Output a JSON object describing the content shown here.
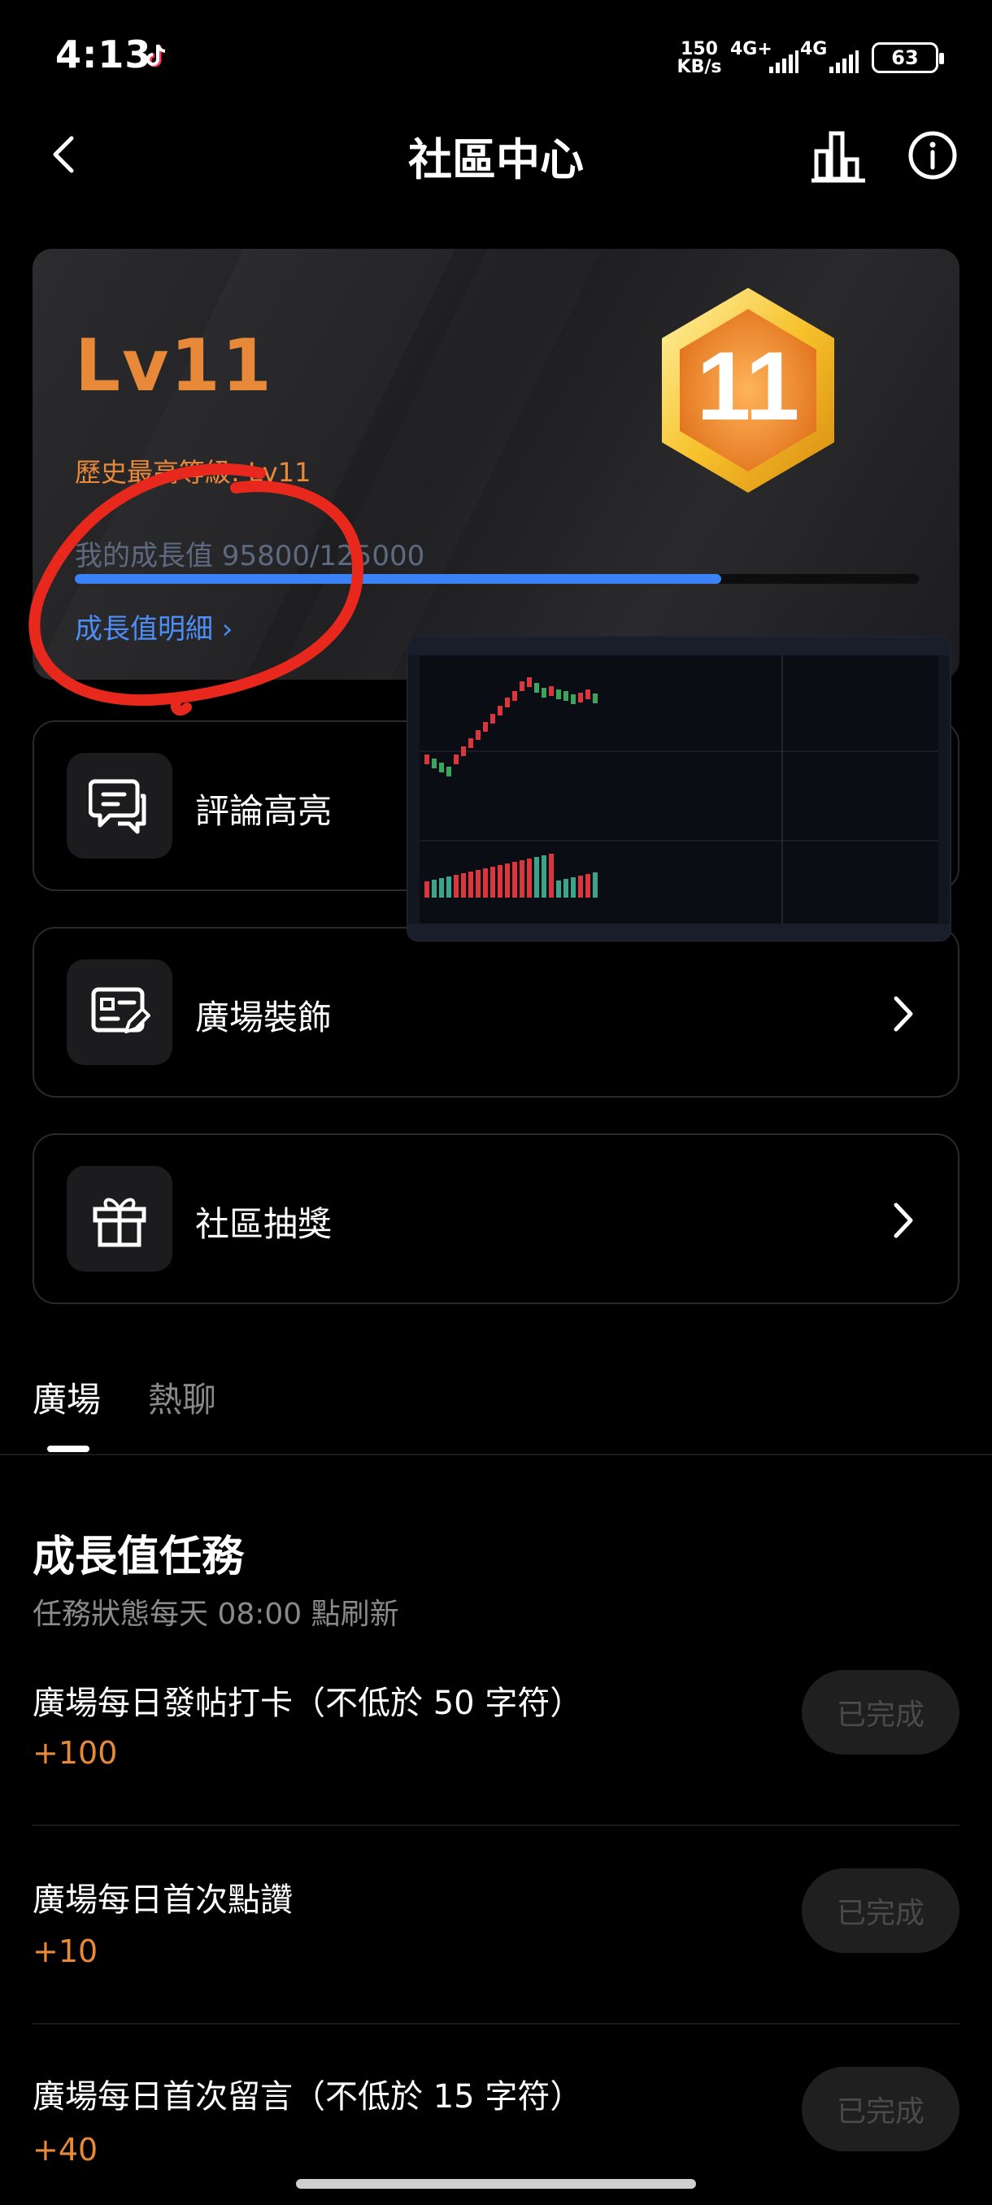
{
  "status_bar": {
    "time": "4:13",
    "speed_value": "150",
    "speed_unit": "KB/s",
    "sig1": "4G+",
    "sig2": "4G",
    "battery": "63"
  },
  "header": {
    "title": "社區中心"
  },
  "level_card": {
    "level": "Lv11",
    "badge_number": "11",
    "history_level": "歷史最高等級: Lv11",
    "growth_text": "我的成長值 95800/125000",
    "progress_fraction": 0.766,
    "detail_link": "成長值明細 ›"
  },
  "menu": [
    {
      "label": "評論高亮"
    },
    {
      "label": "廣場裝飾"
    },
    {
      "label": "社區抽獎"
    }
  ],
  "tabs": [
    {
      "label": "廣場"
    },
    {
      "label": "熱聊"
    }
  ],
  "tasks_section": {
    "title": "成長值任務",
    "subtitle": "任務狀態每天 08:00 點刷新",
    "tasks": [
      {
        "name": "廣場每日發帖打卡（不低於 50 字符）",
        "points": "+100",
        "status": "已完成"
      },
      {
        "name": "廣場每日首次點讚",
        "points": "+10",
        "status": "已完成"
      },
      {
        "name": "廣場每日首次留言（不低於 15 字符）",
        "points": "+40",
        "status": "已完成"
      }
    ]
  },
  "colors": {
    "accent_orange": "#e8893a",
    "progress_blue": "#3b82f6",
    "annotation_red": "#e8281d"
  }
}
